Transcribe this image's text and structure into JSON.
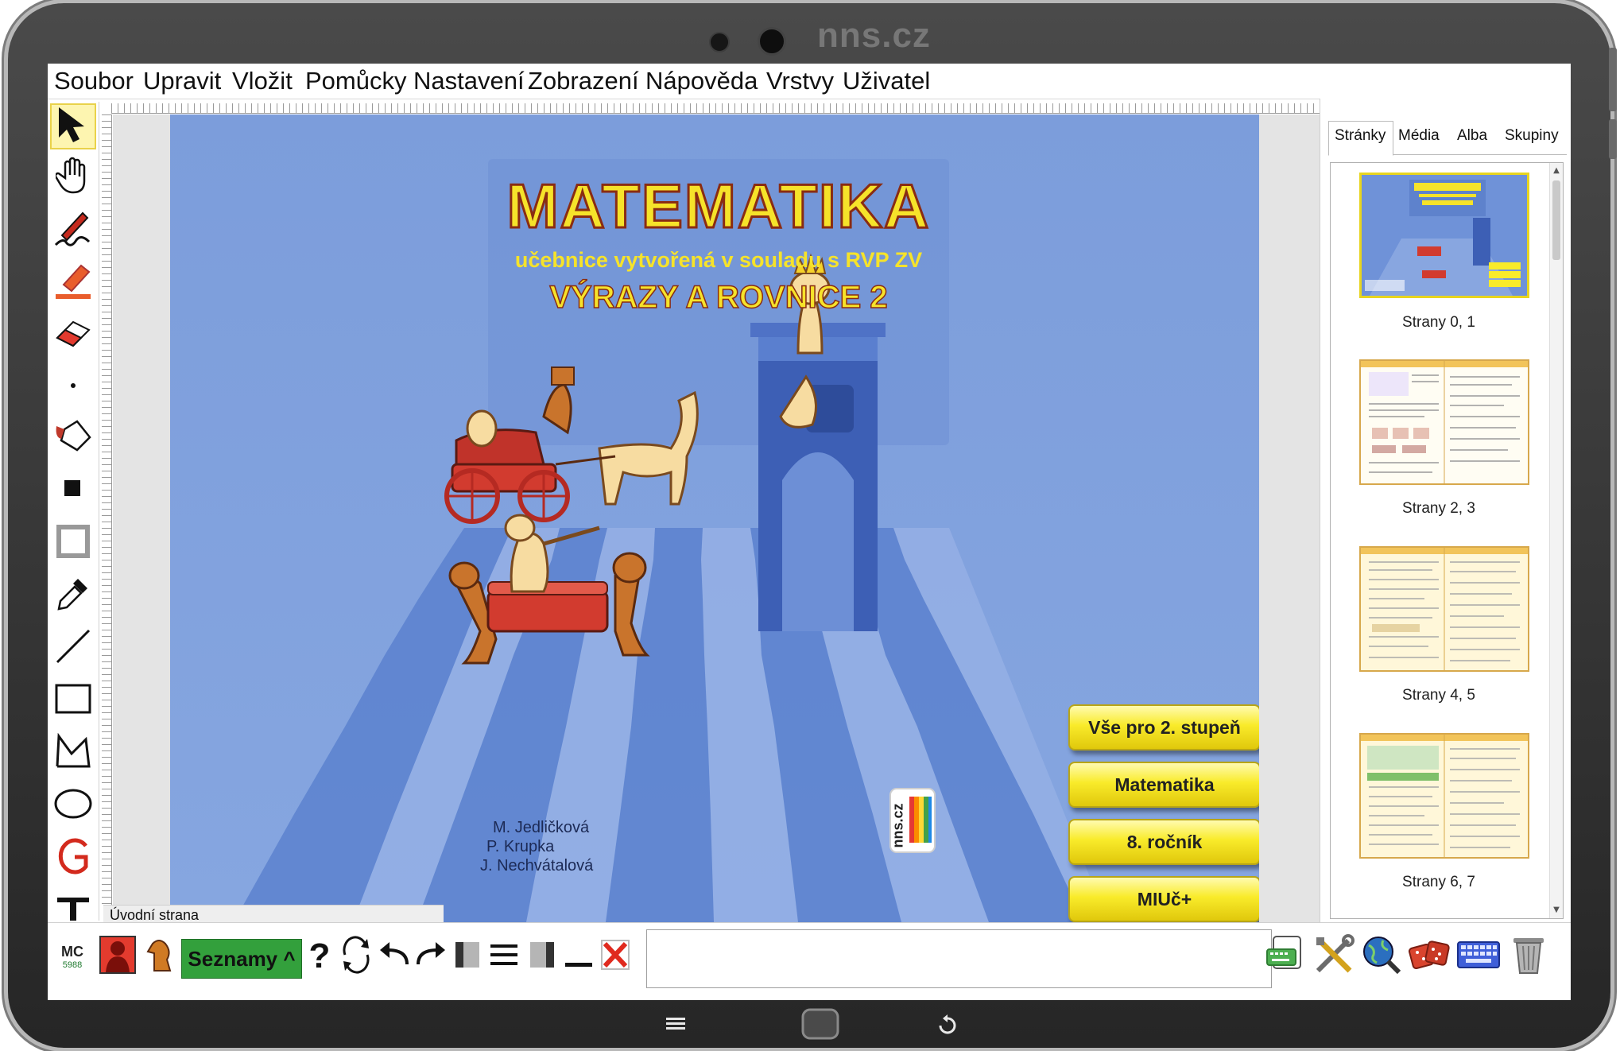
{
  "device": {
    "brand": "nns.cz"
  },
  "menu": [
    "Soubor",
    "Upravit",
    "Vložit",
    "Pomůcky",
    "Nastavení",
    "Zobrazení",
    "Nápověda",
    "Vrstvy",
    "Uživatel"
  ],
  "cover": {
    "title": "MATEMATIKA",
    "subtitle": "učebnice vytvořená v souladu s RVP ZV",
    "volume": "VÝRAZY A ROVNICE 2",
    "authors": [
      "M. Jedličková",
      "P. Krupka",
      "J. Nechvátalová"
    ],
    "buttons": [
      "Vše pro 2. stupeň",
      "Matematika",
      "8. ročník",
      "MIUč+"
    ],
    "publisher_logo": "nns.cz",
    "colors": {
      "background": "#7e9fd9",
      "title_fill": "#f6e32a",
      "title_outline": "#8a2c12",
      "button_yellow": "#f9eb2a"
    }
  },
  "page_name": "Úvodní strana",
  "panel": {
    "tabs": [
      "Stránky",
      "Média",
      "Alba",
      "Skupiny"
    ],
    "active_tab": "Stránky",
    "thumbnails": [
      {
        "label": "Strany 0, 1",
        "selected": true
      },
      {
        "label": "Strany 2, 3",
        "selected": false
      },
      {
        "label": "Strany 4, 5",
        "selected": false
      },
      {
        "label": "Strany 6, 7",
        "selected": false
      }
    ]
  },
  "bottombar": {
    "mc_label": "MC",
    "mc_number": "5988",
    "lists_button": "Seznamy ^",
    "help_glyph": "?"
  },
  "tools": [
    "pointer-icon",
    "hand-icon",
    "pen-icon",
    "highlighter-icon",
    "eraser-icon",
    "dot-icon",
    "fill-bucket-icon",
    "filled-square-icon",
    "outline-square-icon",
    "eyedropper-icon",
    "line-icon",
    "rectangle-icon",
    "polygon-icon",
    "ellipse-icon",
    "g-icon",
    "text-icon"
  ]
}
